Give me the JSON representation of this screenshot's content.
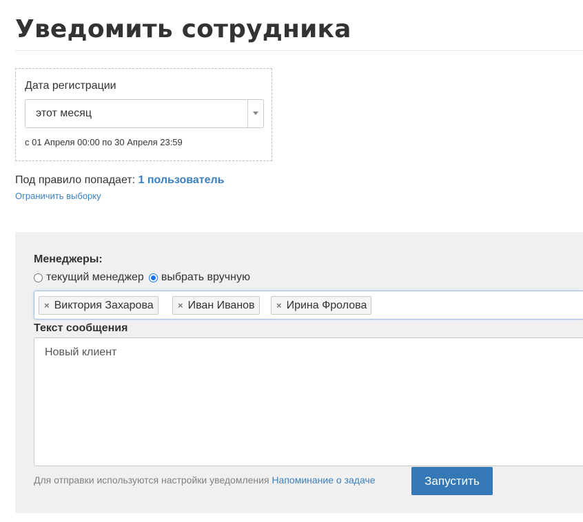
{
  "page": {
    "title": "Уведомить сотрудника"
  },
  "filter": {
    "label": "Дата регистрации",
    "selected_value": "этот месяц",
    "date_range": "с 01 Апреля 00:00 по 30 Апреля 23:59"
  },
  "match": {
    "prefix": "Под правило попадает:",
    "count_link": "1 пользователь",
    "limit_link": "Ограничить выборку"
  },
  "managers": {
    "label": "Менеджеры:",
    "radio_current": "текущий менеджер",
    "radio_manual": "выбрать вручную",
    "selected_mode": "manual",
    "selected": [
      {
        "name": "Виктория Захарова",
        "remove": "×"
      },
      {
        "name": "Иван Иванов",
        "remove": "×"
      },
      {
        "name": "Ирина Фролова",
        "remove": "×"
      }
    ]
  },
  "message": {
    "label": "Текст сообщения",
    "value": "Новый клиент"
  },
  "footer": {
    "note": "Для отправки используются настройки уведомления",
    "note_link": "Напоминание о задаче",
    "run_button": "Запустить"
  },
  "colors": {
    "link": "#3a7fbf",
    "primary_button": "#3478b5",
    "panel_background": "#f0f0f0"
  },
  "icons": {
    "select_arrow": "caret-down-icon",
    "tag_remove": "close-icon"
  }
}
